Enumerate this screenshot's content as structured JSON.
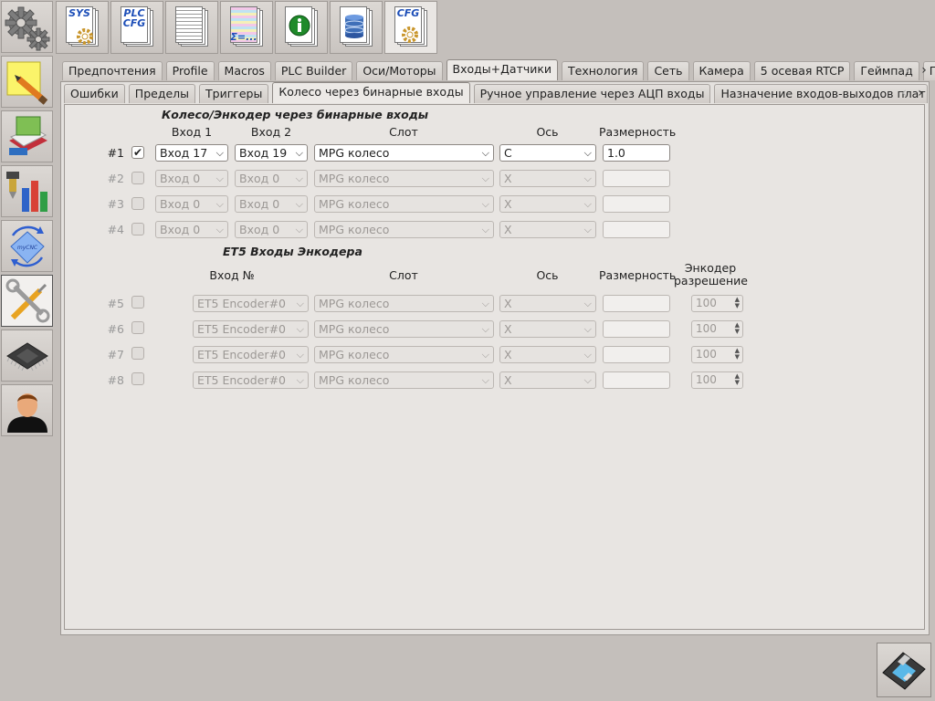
{
  "toolbar": {
    "sys_label": "SYS",
    "plc_label": "PLC CFG",
    "cfg_label": "CFG",
    "sum_label": "Σ=..."
  },
  "sidebar": {
    "items": [
      "gear-icon",
      "pencil-note-icon",
      "book-icon",
      "bar-chart-icon",
      "rotate-icon",
      "tools-icon",
      "chip-icon",
      "user-icon"
    ],
    "badge_text": "myCNC"
  },
  "main_tabs": [
    {
      "label": "Предпочтения"
    },
    {
      "label": "Profile"
    },
    {
      "label": "Macros"
    },
    {
      "label": "PLC Builder"
    },
    {
      "label": "Оси/Моторы"
    },
    {
      "label": "Входы+Датчики"
    },
    {
      "label": "Технология"
    },
    {
      "label": "Сеть"
    },
    {
      "label": "Камера"
    },
    {
      "label": "5 осевая RTCP"
    },
    {
      "label": "Геймпад"
    },
    {
      "label": "Пул"
    }
  ],
  "sub_tabs": [
    {
      "label": "Ошибки"
    },
    {
      "label": "Пределы"
    },
    {
      "label": "Триггеры"
    },
    {
      "label": "Колесо через бинарные входы"
    },
    {
      "label": "Ручное управление через АЦП входы"
    },
    {
      "label": "Назначение входов-выходов плат ра"
    }
  ],
  "section1": {
    "title": "Колесо/Энкодер через бинарные входы",
    "headers": {
      "input1": "Вход 1",
      "input2": "Вход 2",
      "slot": "Слот",
      "axis": "Ось",
      "dimension": "Размерность"
    },
    "rows": [
      {
        "label": "#1",
        "checked": "✔",
        "input1": "Вход 17",
        "input2": "Вход 19",
        "slot": "MPG колесо",
        "axis": "C",
        "dimension": "1.0"
      },
      {
        "label": "#2",
        "checked": "",
        "input1": "Вход 0",
        "input2": "Вход 0",
        "slot": "MPG колесо",
        "axis": "X",
        "dimension": ""
      },
      {
        "label": "#3",
        "checked": "",
        "input1": "Вход 0",
        "input2": "Вход 0",
        "slot": "MPG колесо",
        "axis": "X",
        "dimension": ""
      },
      {
        "label": "#4",
        "checked": "",
        "input1": "Вход 0",
        "input2": "Вход 0",
        "slot": "MPG колесо",
        "axis": "X",
        "dimension": ""
      }
    ]
  },
  "section2": {
    "title": "ET5 Входы Энкодера",
    "headers": {
      "input_no": "Вход №",
      "slot": "Слот",
      "axis": "Ось",
      "dimension": "Размерность",
      "encoder_res_1": "Энкодер",
      "encoder_res_2": "разрешение"
    },
    "rows": [
      {
        "label": "#5",
        "encoder": "ET5 Encoder#0",
        "slot": "MPG колесо",
        "axis": "X",
        "dimension": "",
        "resolution": "100"
      },
      {
        "label": "#6",
        "encoder": "ET5 Encoder#0",
        "slot": "MPG колесо",
        "axis": "X",
        "dimension": "",
        "resolution": "100"
      },
      {
        "label": "#7",
        "encoder": "ET5 Encoder#0",
        "slot": "MPG колесо",
        "axis": "X",
        "dimension": "",
        "resolution": "100"
      },
      {
        "label": "#8",
        "encoder": "ET5 Encoder#0",
        "slot": "MPG колесо",
        "axis": "X",
        "dimension": "",
        "resolution": "100"
      }
    ]
  },
  "colors": {
    "accent": "#1e4fb8",
    "panel": "#e8e5e2",
    "background": "#c4bfbb"
  }
}
